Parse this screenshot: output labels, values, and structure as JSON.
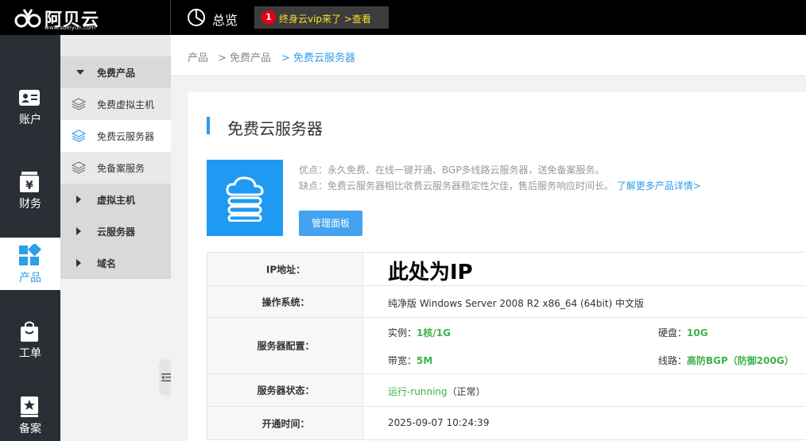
{
  "header": {
    "logo_text": "阿贝云",
    "logo_url": "www.abeiyun.com",
    "overview_label": "总览",
    "vip_badge_count": "1",
    "vip_text": "终身云vip来了  >查看"
  },
  "leftnav": {
    "items": [
      {
        "label": "账户",
        "icon": "id-card-icon"
      },
      {
        "label": "财务",
        "icon": "yen-icon"
      },
      {
        "label": "产品",
        "icon": "grid-icon",
        "active": true
      },
      {
        "label": "工单",
        "icon": "bag-icon"
      },
      {
        "label": "备案",
        "icon": "star-doc-icon"
      }
    ]
  },
  "subnav": {
    "items": [
      {
        "label": "免费产品",
        "type": "group-open"
      },
      {
        "label": "免费虚拟主机",
        "type": "child"
      },
      {
        "label": "免费云服务器",
        "type": "child",
        "active": true
      },
      {
        "label": "免备案服务",
        "type": "child"
      },
      {
        "label": "虚拟主机",
        "type": "group"
      },
      {
        "label": "云服务器",
        "type": "group"
      },
      {
        "label": "域名",
        "type": "group"
      }
    ]
  },
  "breadcrumb": {
    "items": [
      "产品",
      "> 免费产品",
      "> 免费云服务器"
    ]
  },
  "product": {
    "title": "免费云服务器",
    "pros": "优点：永久免费、在线一键开通、BGP多线路云服务器，送免备案服务。",
    "cons": "缺点：免费云服务器相比收费云服务器稳定性欠佳，售后服务响应时间长。",
    "more_link": "了解更多产品详情>",
    "manage_button": "管理面板"
  },
  "info": {
    "ip_label": "IP地址：",
    "ip_value": "此处为IP",
    "os_label": "操作系统：",
    "os_value": "纯净版 Windows Server 2008 R2 x86_64 (64bit) 中文版",
    "config_label": "服务器配置：",
    "cpu_label": "实例：",
    "cpu_value": "1核/1G",
    "disk_label": "硬盘：",
    "disk_value": "10G",
    "bandwidth_label": "带宽：",
    "bandwidth_value": "5M",
    "line_label": "线路：",
    "line_value": "高防BGP（防御200G）",
    "status_label": "服务器状态：",
    "status_value": "运行-running",
    "status_note": "（正常）",
    "open_time_label": "开通时间：",
    "open_time_value": "2025-09-07 10:24:39"
  },
  "colors": {
    "accent": "#2d9ee8",
    "topbar": "#000000",
    "leftnav": "#2a2f35",
    "vip_text": "#ffdf2b",
    "green": "#3db24b"
  }
}
